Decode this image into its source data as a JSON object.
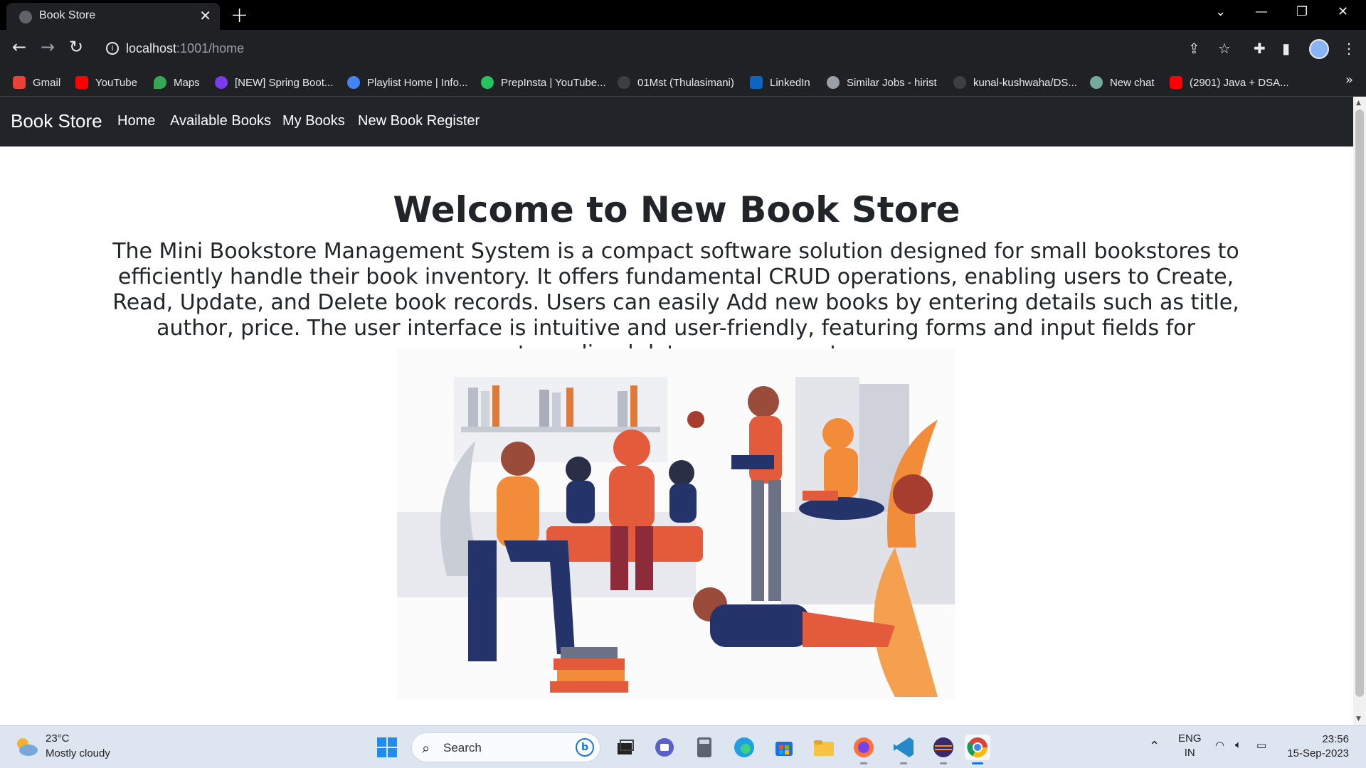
{
  "browser": {
    "tab_title": "Book Store",
    "tab_close": "✕",
    "new_tab": "+",
    "window_controls": [
      "⌄",
      "—",
      "❐",
      "✕"
    ],
    "url_host": "localhost",
    "url_path": ":1001/home",
    "bookmarks": [
      {
        "label": "Gmail",
        "color": "#ea4335"
      },
      {
        "label": "YouTube",
        "color": "#ff0000"
      },
      {
        "label": "Maps",
        "color": "#34a853"
      },
      {
        "label": "[NEW] Spring Boot...",
        "color": "#7c3aed"
      },
      {
        "label": "Playlist Home | Info...",
        "color": "#4285f4"
      },
      {
        "label": "PrepInsta | YouTube...",
        "color": "#22c55e"
      },
      {
        "label": "01Mst (Thulasimani)",
        "color": "#3c4043"
      },
      {
        "label": "LinkedIn",
        "color": "#0a66c2"
      },
      {
        "label": "Similar Jobs - hirist",
        "color": "#9aa0a6"
      },
      {
        "label": "kunal-kushwaha/DS...",
        "color": "#3c4043"
      },
      {
        "label": "New chat",
        "color": "#74aa9c"
      },
      {
        "label": "(2901) Java + DSA...",
        "color": "#ff0000"
      }
    ],
    "bookmarks_more": "»"
  },
  "app": {
    "brand": "Book Store",
    "nav": [
      "Home",
      "Available Books",
      "My Books",
      "New Book Register"
    ],
    "heading": "Welcome to New Book Store",
    "description": "The Mini Bookstore Management System is a compact software solution designed for small bookstores to efficiently handle their book inventory. It offers fundamental CRUD operations, enabling users to Create, Read, Update, and Delete book records. Users can easily Add new books by entering details such as title, author, price. The user interface is intuitive and user-friendly, featuring forms and input fields for streamlined data management."
  },
  "taskbar": {
    "temperature": "23°C",
    "weather": "Mostly cloudy",
    "search_placeholder": "Search",
    "language": "ENG",
    "region": "IN",
    "time": "23:56",
    "date": "15-Sep-2023"
  },
  "colors": {
    "navbar_bg": "#212529",
    "chrome_bg": "#202124",
    "taskbar_bg": "#dde5f1",
    "illustration_orange": "#f28c38",
    "illustration_navy": "#24346b"
  }
}
